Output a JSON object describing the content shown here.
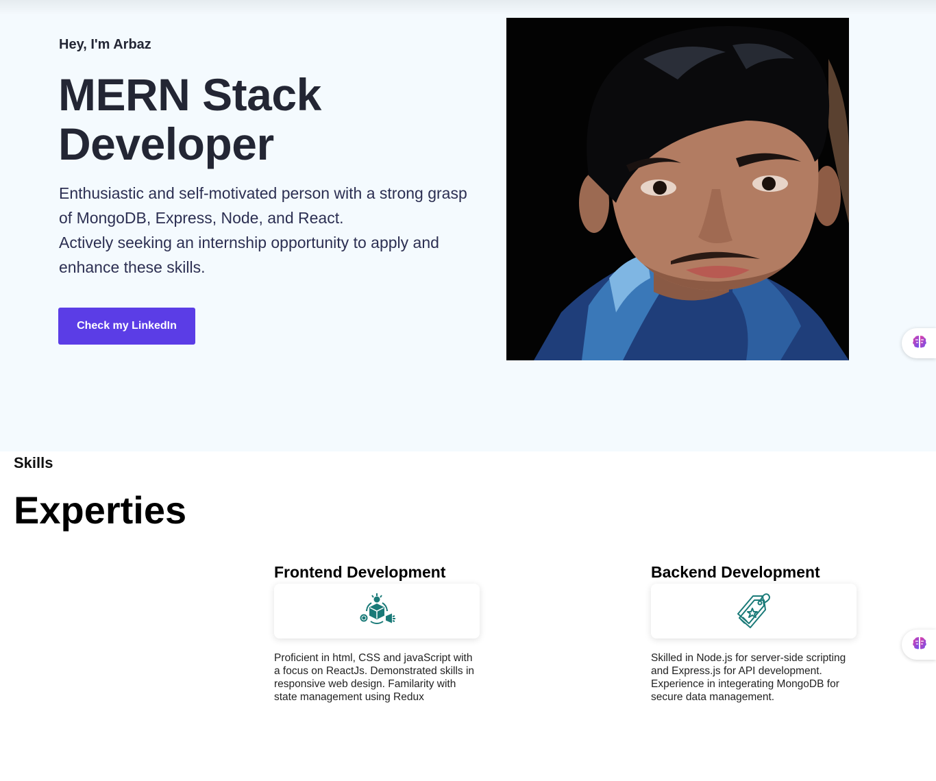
{
  "hero": {
    "greeting": "Hey, I'm Arbaz",
    "title": "MERN Stack Developer",
    "description_line1": "Enthusiastic and self-motivated person with a strong grasp of MongoDB, Express, Node, and React.",
    "description_line2": "Actively seeking an internship opportunity to apply and enhance these skills.",
    "cta_label": "Check my LinkedIn"
  },
  "skills": {
    "tag": "Skills",
    "title": "Experties",
    "items": [
      {
        "name": "Frontend Development",
        "icon": "frontend-dev-icon",
        "description": "Proficient in html, CSS and javaScript with a focus on ReactJs. Demonstrated skills in responsive web design. Familarity with state management using Redux"
      },
      {
        "name": "Backend Development",
        "icon": "price-tag-icon",
        "description": "Skilled in Node.js for server-side scripting and Express.js for API development. Experience in integerating MongoDB for secure data management."
      }
    ]
  },
  "colors": {
    "accent": "#5b3de6",
    "hero_bg": "#f4fafe",
    "icon_teal": "#1a7a78"
  }
}
